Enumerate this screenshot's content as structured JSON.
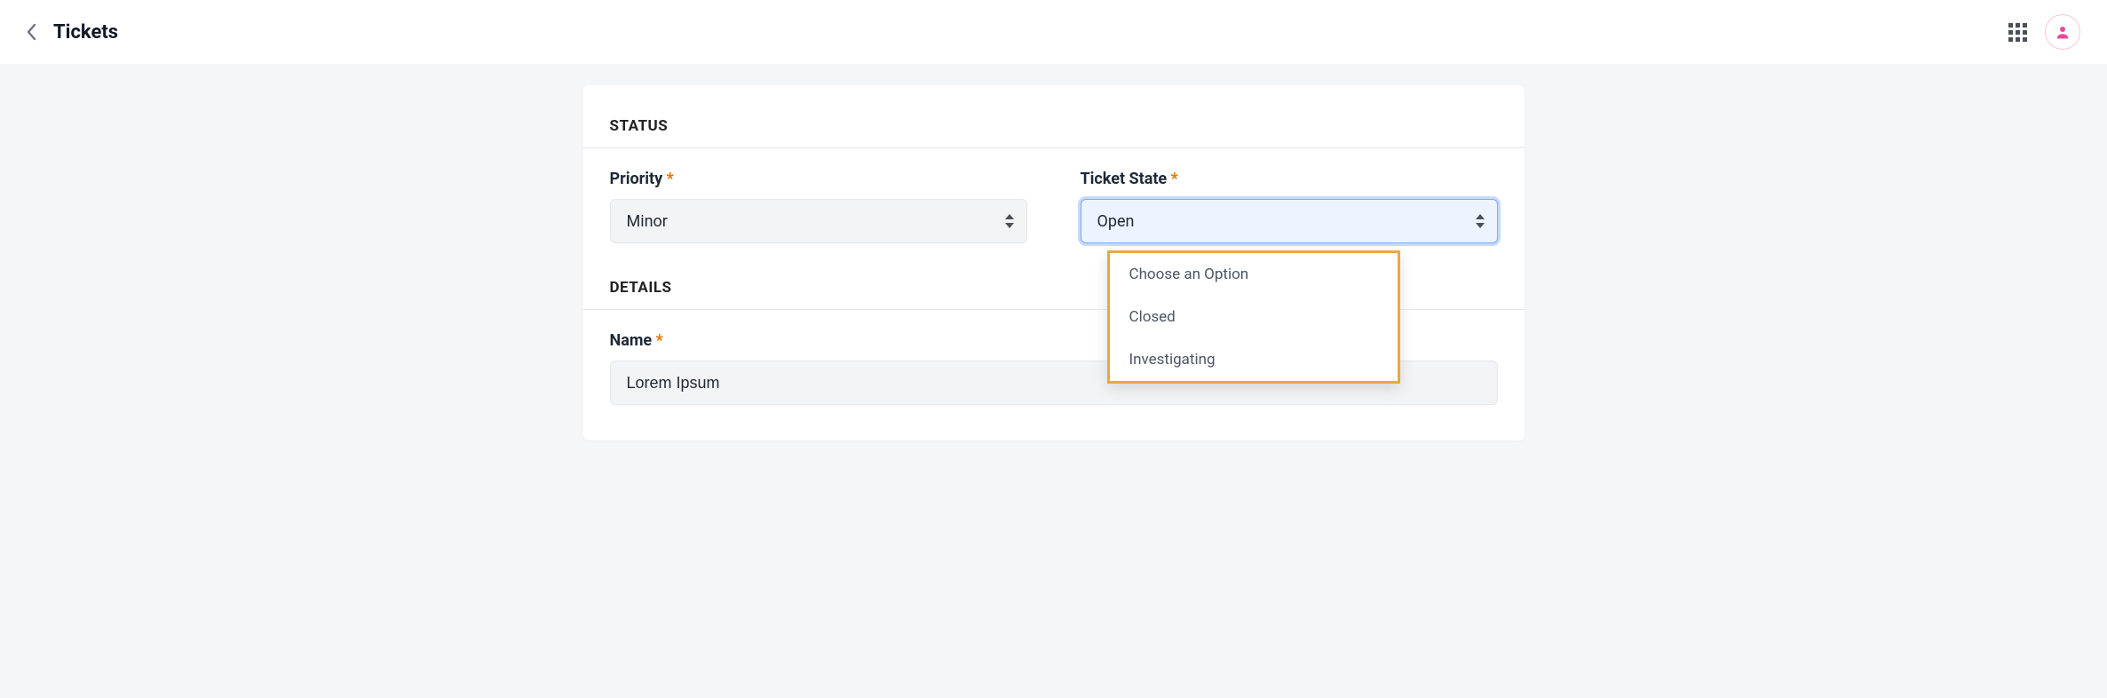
{
  "header": {
    "title": "Tickets"
  },
  "sections": {
    "status_heading": "STATUS",
    "details_heading": "DETAILS"
  },
  "fields": {
    "priority": {
      "label": "Priority",
      "value": "Minor"
    },
    "ticket_state": {
      "label": "Ticket State",
      "value": "Open",
      "options": {
        "placeholder": "Choose an Option",
        "opt1": "Closed",
        "opt2": "Investigating"
      }
    },
    "name": {
      "label": "Name",
      "value": "Lorem Ipsum"
    }
  },
  "required_marker": "*"
}
